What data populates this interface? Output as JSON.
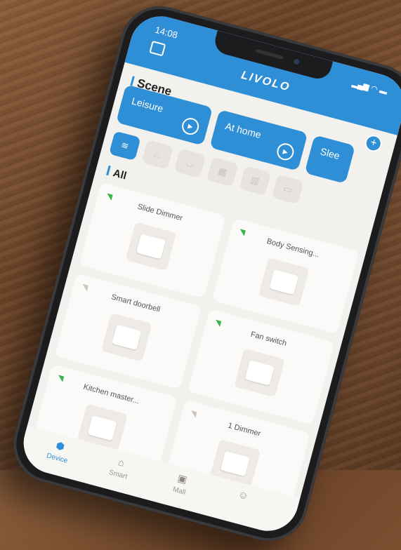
{
  "status_bar": {
    "time": "14:08"
  },
  "header": {
    "brand": "LIVOLO"
  },
  "scene": {
    "title": "Scene",
    "cards": [
      {
        "label": "Leisure"
      },
      {
        "label": "At home"
      },
      {
        "label": "Slee"
      }
    ]
  },
  "all": {
    "title": "All"
  },
  "devices": [
    {
      "name": "Slide Dimmer",
      "online": true
    },
    {
      "name": "Body Sensing...",
      "online": true
    },
    {
      "name": "Smart doorbell",
      "online": false
    },
    {
      "name": "Fan switch",
      "online": true
    },
    {
      "name": "Kitchen master...",
      "online": true
    },
    {
      "name": "1 Dimmer",
      "online": false
    }
  ],
  "tabs": [
    {
      "label": "Device"
    },
    {
      "label": "Smart"
    },
    {
      "label": "Mall"
    },
    {
      "label": ""
    }
  ],
  "colors": {
    "accent": "#2f8fd6",
    "online": "#3ab44a"
  }
}
